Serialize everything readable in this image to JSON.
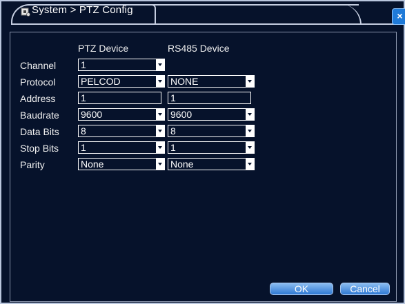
{
  "window": {
    "title": "System > PTZ Config"
  },
  "columns": {
    "ptz": "PTZ Device",
    "rs485": "RS485 Device"
  },
  "rows": {
    "channel": {
      "label": "Channel",
      "ptz_value": "1"
    },
    "protocol": {
      "label": "Protocol",
      "ptz_value": "PELCOD",
      "rs485_value": "NONE"
    },
    "address": {
      "label": "Address",
      "ptz_value": "1",
      "rs485_value": "1"
    },
    "baudrate": {
      "label": "Baudrate",
      "ptz_value": "9600",
      "rs485_value": "9600"
    },
    "data_bits": {
      "label": "Data Bits",
      "ptz_value": "8",
      "rs485_value": "8"
    },
    "stop_bits": {
      "label": "Stop Bits",
      "ptz_value": "1",
      "rs485_value": "1"
    },
    "parity": {
      "label": "Parity",
      "ptz_value": "None",
      "rs485_value": "None"
    }
  },
  "buttons": {
    "ok": "OK",
    "cancel": "Cancel"
  },
  "icons": {
    "title": "settings-icon",
    "close": "close-icon"
  },
  "colors": {
    "background": "#06122b",
    "frame": "#b9c6dd",
    "button": "#2f79d4"
  }
}
